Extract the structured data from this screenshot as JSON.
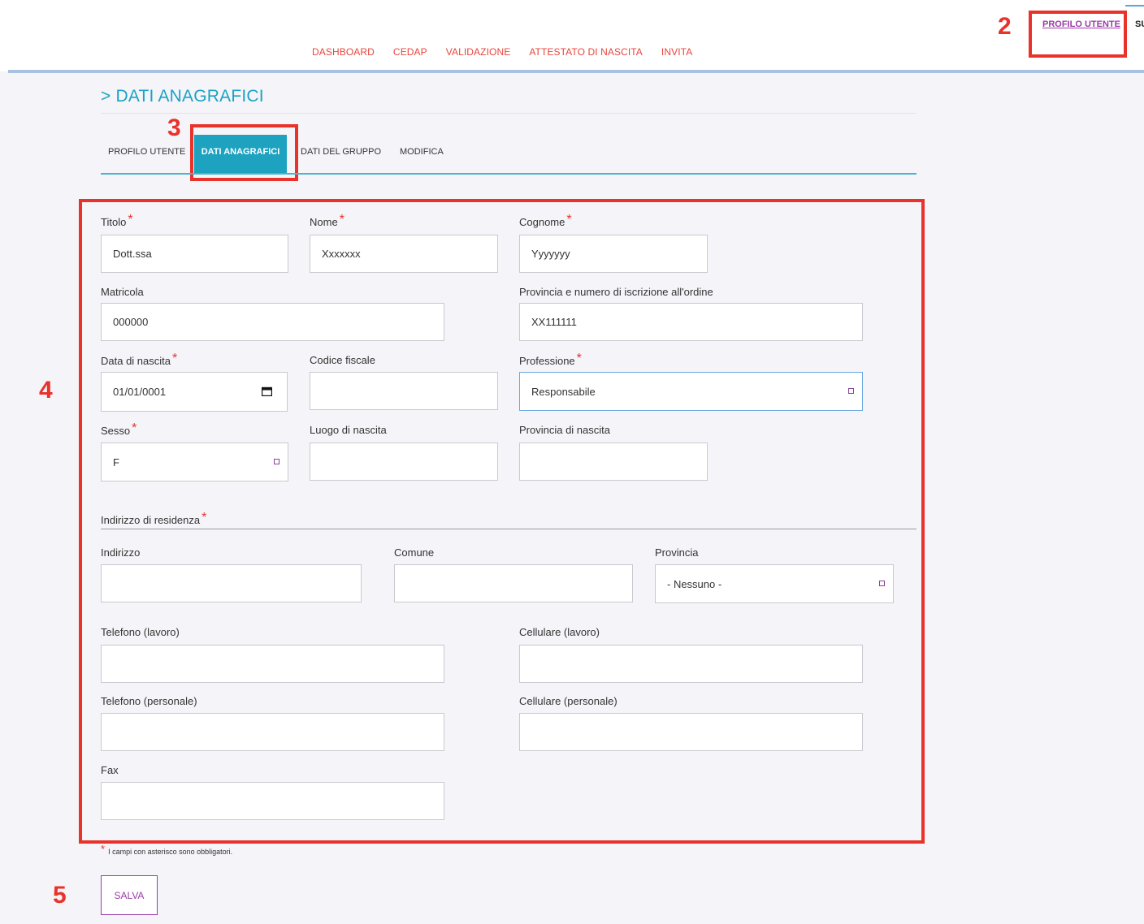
{
  "header": {
    "nav": [
      "DASHBOARD",
      "CEDAP",
      "VALIDAZIONE",
      "ATTESTATO DI NASCITA",
      "INVITA"
    ],
    "user_link": "PROFILO UTENTE",
    "truncated_link": "SU"
  },
  "annotations": [
    "2",
    "3",
    "4",
    "5"
  ],
  "page": {
    "title": "> DATI ANAGRAFICI",
    "tabs": [
      "PROFILO UTENTE",
      "DATI ANAGRAFICI",
      "DATI DEL GRUPPO",
      "MODIFICA"
    ]
  },
  "form": {
    "titolo": {
      "label": "Titolo",
      "value": "Dott.ssa"
    },
    "nome": {
      "label": "Nome",
      "value": "Xxxxxxx"
    },
    "cognome": {
      "label": "Cognome",
      "value": "Yyyyyyy"
    },
    "matricola": {
      "label": "Matricola",
      "value": "000000"
    },
    "iscrizione": {
      "label": "Provincia e numero di iscrizione all'ordine",
      "value": "XX111111"
    },
    "data_nascita": {
      "label": "Data di nascita",
      "value": "01/01/0001"
    },
    "codice_fiscale": {
      "label": "Codice fiscale",
      "value": ""
    },
    "professione": {
      "label": "Professione",
      "value": "Responsabile"
    },
    "sesso": {
      "label": "Sesso",
      "value": "F"
    },
    "luogo_nascita": {
      "label": "Luogo di nascita",
      "value": ""
    },
    "provincia_nascita": {
      "label": "Provincia di nascita",
      "value": ""
    },
    "residenza_section": "Indirizzo di residenza",
    "indirizzo": {
      "label": "Indirizzo",
      "value": ""
    },
    "comune": {
      "label": "Comune",
      "value": ""
    },
    "provincia": {
      "label": "Provincia",
      "value": "- Nessuno -"
    },
    "tel_lavoro": {
      "label": "Telefono (lavoro)",
      "value": ""
    },
    "cell_lavoro": {
      "label": "Cellulare (lavoro)",
      "value": ""
    },
    "tel_personale": {
      "label": "Telefono (personale)",
      "value": ""
    },
    "cell_personale": {
      "label": "Cellulare (personale)",
      "value": ""
    },
    "fax": {
      "label": "Fax",
      "value": ""
    },
    "required_mark": "*"
  },
  "footnote": "I campi con asterisco sono obbligatori.",
  "save_label": "SALVA",
  "colors": {
    "accent": "#1da2c0",
    "nav": "#e8453c",
    "annotation": "#e8322a",
    "button": "#9b3ba8"
  }
}
